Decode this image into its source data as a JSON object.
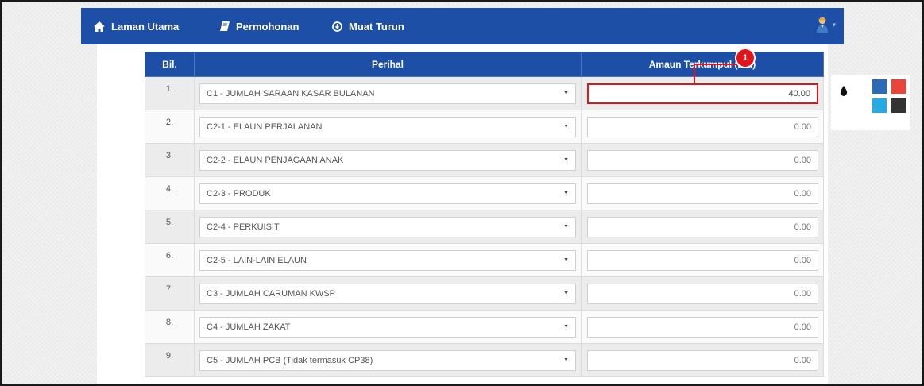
{
  "nav": {
    "items": [
      {
        "label": "Laman Utama",
        "icon": "home-icon"
      },
      {
        "label": "Permohonan",
        "icon": "book-icon"
      },
      {
        "label": "Muat Turun",
        "icon": "download-icon"
      }
    ],
    "user_icon": "user-avatar-icon",
    "caret": "chevron-down-icon"
  },
  "table": {
    "headers": [
      "Bil.",
      "Perihal",
      "Amaun Terkumpul (RM)"
    ],
    "rows": [
      {
        "bil": "1.",
        "perihal": "C1 - JUMLAH SARAAN KASAR BULANAN",
        "amaun": "40.00"
      },
      {
        "bil": "2.",
        "perihal": "C2-1 - ELAUN PERJALANAN",
        "amaun": "0.00"
      },
      {
        "bil": "3.",
        "perihal": "C2-2 - ELAUN PENJAGAAN ANAK",
        "amaun": "0.00"
      },
      {
        "bil": "4.",
        "perihal": "C2-3 - PRODUK",
        "amaun": "0.00"
      },
      {
        "bil": "5.",
        "perihal": "C2-4 - PERKUISIT",
        "amaun": "0.00"
      },
      {
        "bil": "6.",
        "perihal": "C2-5 - LAIN-LAIN ELAUN",
        "amaun": "0.00"
      },
      {
        "bil": "7.",
        "perihal": "C3 - JUMLAH CARUMAN KWSP",
        "amaun": "0.00"
      },
      {
        "bil": "8.",
        "perihal": "C4 - JUMLAH ZAKAT",
        "amaun": "0.00"
      },
      {
        "bil": "9.",
        "perihal": "C5 - JUMLAH PCB (Tidak termasuk CP38)",
        "amaun": "0.00"
      }
    ]
  },
  "callout": {
    "number": "1",
    "color": "#e2141a"
  },
  "theme_panel": {
    "icon": "color-drop-icon",
    "swatches": [
      "#2b6bb5",
      "#e8463a",
      "#27a9e1",
      "#333333"
    ]
  },
  "colors": {
    "navbar": "#1c4fa5",
    "highlight": "#e2141a"
  }
}
